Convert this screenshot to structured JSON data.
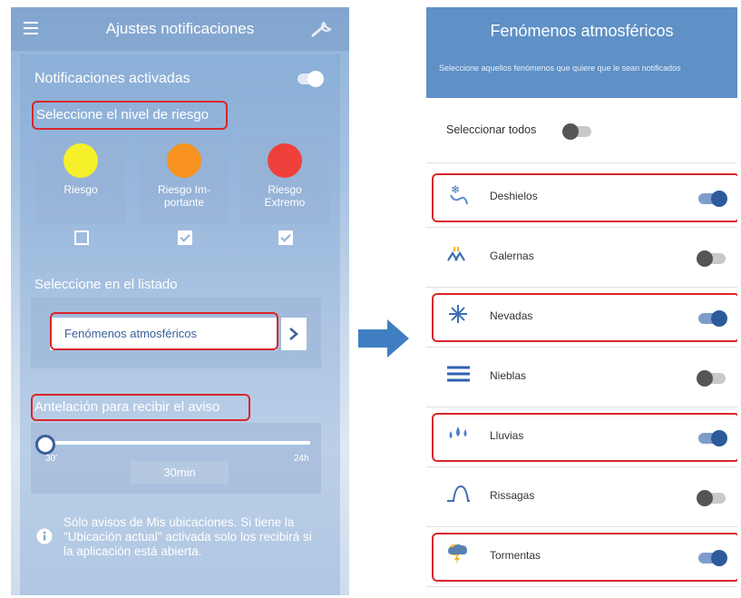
{
  "left": {
    "title": "Ajustes notificaciones",
    "notifications_label": "Notificaciones activadas",
    "risk_section": "Seleccione el nivel de riesgo",
    "risk_levels": [
      {
        "label_lines": [
          "Riesgo",
          ""
        ],
        "color": "#f6f02a",
        "checked": false
      },
      {
        "label_lines": [
          "Riesgo Im-",
          "portante"
        ],
        "color": "#f7931e",
        "checked": true
      },
      {
        "label_lines": [
          "Riesgo",
          "Extremo"
        ],
        "color": "#f0403b",
        "checked": true
      }
    ],
    "list_section": "Seleccione en el listado",
    "list_button": "Fenómenos atmosféricos",
    "advance_section": "Antelación para recibir el aviso",
    "slider": {
      "min_label": "30'",
      "max_label": "24h",
      "value_label": "30min",
      "fraction": 0.0
    },
    "info_text": "Sólo avisos de Mis ubicaciones. Si tiene la \"Ubicación actual\" activada solo los recibirá si la aplicación está abierta."
  },
  "right": {
    "title": "Fenómenos atmosféricos",
    "subtitle": "Seleccione aquellos fenómenos que quiere que le sean notificados",
    "select_all": "Seleccionar todos",
    "items": [
      {
        "label": "Deshielos",
        "icon": "thaw-icon",
        "on": true,
        "highlighted": true
      },
      {
        "label": "Galernas",
        "icon": "gale-icon",
        "on": false,
        "highlighted": false
      },
      {
        "label": "Nevadas",
        "icon": "snowflake-icon",
        "on": true,
        "highlighted": true
      },
      {
        "label": "Nieblas",
        "icon": "fog-icon",
        "on": false,
        "highlighted": false
      },
      {
        "label": "Lluvias",
        "icon": "rain-icon",
        "on": true,
        "highlighted": true
      },
      {
        "label": "Rissagas",
        "icon": "wave-icon",
        "on": false,
        "highlighted": false
      },
      {
        "label": "Tormentas",
        "icon": "storm-icon",
        "on": true,
        "highlighted": true
      }
    ]
  },
  "colors": {
    "accent": "#5f90c6",
    "highlight": "#d9262b",
    "arrow": "#3f7fc1"
  }
}
